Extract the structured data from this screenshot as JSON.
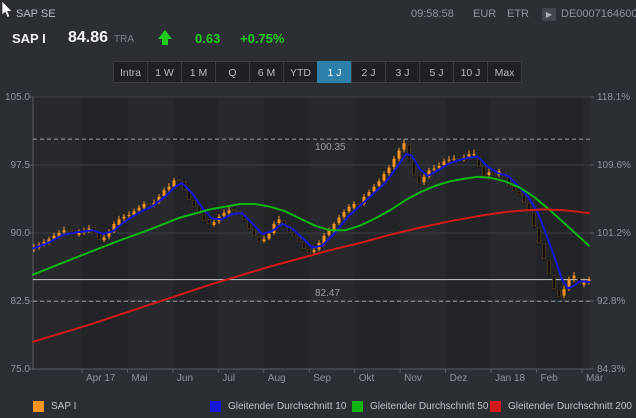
{
  "header": {
    "instrument": "SAP SE",
    "time": "09:58:58",
    "currency": "EUR",
    "exchange": "ETR",
    "isin": "DE0007164600",
    "isin_button_glyph": "▶",
    "symbol": "SAP I",
    "price": "84.86",
    "venue": "TRA",
    "change": "0.63",
    "change_pct": "+0.75%",
    "up_color": "#1ecb1e"
  },
  "ranges": {
    "items": [
      "Intra",
      "1 W",
      "1 M",
      "Q",
      "6 M",
      "YTD",
      "1 J",
      "2 J",
      "3 J",
      "5 J",
      "10 J",
      "Max"
    ],
    "selected": "1 J"
  },
  "legend": [
    {
      "label": "SAP I",
      "color": "#f7941e"
    },
    {
      "label": "Gleitender Durchschnitt 10",
      "color": "#1717d8"
    },
    {
      "label": "Gleitender Durchschnitt 50",
      "color": "#0fb50f"
    },
    {
      "label": "Gleitender Durchschnitt 200",
      "color": "#d21a1a"
    }
  ],
  "chart_data": {
    "type": "candlestick",
    "period": "1 J",
    "ylim": [
      75,
      105
    ],
    "y_axis_left_labels": [
      "105.0",
      "97.5",
      "90.0",
      "82.5",
      "75.0"
    ],
    "y_axis_left_values": [
      105.0,
      97.5,
      90.0,
      82.5,
      75.0
    ],
    "y_axis_right_labels": [
      "118.1%",
      "109.6%",
      "101.2%",
      "92.8%",
      "84.3%"
    ],
    "x_axis_labels": [
      "Apr 17",
      "Mai",
      "Jun",
      "Jul",
      "Aug",
      "Sep",
      "Okt",
      "Nov",
      "Dez",
      "Jan 18",
      "Feb",
      "Mär"
    ],
    "annotations": {
      "period_high": {
        "label": "100.35",
        "price": 100.35
      },
      "period_low": {
        "label": "82.47",
        "price": 82.47
      },
      "last_price": {
        "price": 84.86
      }
    },
    "colors": {
      "candle_up": "#f7941e",
      "candle_down": "#101010",
      "ma10": "#1717d8",
      "ma50": "#0fb50f",
      "ma200": "#d21a1a",
      "grid": "#3c4046",
      "axis": "#585c63",
      "band_light": "#27292d",
      "band_dark": "#222428",
      "dashed_line": "#9aa0a6",
      "last_price_line": "#c7cbd1"
    },
    "candles": [
      [
        88.2,
        88.8,
        87.9,
        88.4
      ],
      [
        88.4,
        89.0,
        88.2,
        88.7
      ],
      [
        88.8,
        89.3,
        88.5,
        89.0
      ],
      [
        88.9,
        89.6,
        88.7,
        89.3
      ],
      [
        89.4,
        90.0,
        89.2,
        89.7
      ],
      [
        89.6,
        90.3,
        89.4,
        90.0
      ],
      [
        90.1,
        90.7,
        89.8,
        90.3
      ],
      [
        90.4,
        90.8,
        90.0,
        90.2
      ],
      [
        90.3,
        90.5,
        89.6,
        89.9
      ],
      [
        89.8,
        90.4,
        89.6,
        90.0
      ],
      [
        90.1,
        90.6,
        89.8,
        90.2
      ],
      [
        90.3,
        90.9,
        90.0,
        90.5
      ],
      [
        90.6,
        90.8,
        89.8,
        90.0
      ],
      [
        90.1,
        90.2,
        89.0,
        89.3
      ],
      [
        89.2,
        89.9,
        89.0,
        89.5
      ],
      [
        89.6,
        90.4,
        89.3,
        90.1
      ],
      [
        90.2,
        91.3,
        90.0,
        91.0
      ],
      [
        90.9,
        91.9,
        90.7,
        91.5
      ],
      [
        91.6,
        92.1,
        91.3,
        91.8
      ],
      [
        91.9,
        92.4,
        91.6,
        92.0
      ],
      [
        92.0,
        92.7,
        91.8,
        92.4
      ],
      [
        92.5,
        93.1,
        92.2,
        92.8
      ],
      [
        92.8,
        93.5,
        92.6,
        93.2
      ],
      [
        93.3,
        93.6,
        92.8,
        93.1
      ],
      [
        93.1,
        93.7,
        92.9,
        93.3
      ],
      [
        93.4,
        94.3,
        93.2,
        94.0
      ],
      [
        94.1,
        95.0,
        93.8,
        94.7
      ],
      [
        94.8,
        95.5,
        94.5,
        95.1
      ],
      [
        95.1,
        96.1,
        94.9,
        95.8
      ],
      [
        95.9,
        96.4,
        95.4,
        95.8
      ],
      [
        95.7,
        95.9,
        94.5,
        94.8
      ],
      [
        94.7,
        94.9,
        93.4,
        93.7
      ],
      [
        93.6,
        94.1,
        92.6,
        92.9
      ],
      [
        93.0,
        93.2,
        91.8,
        92.1
      ],
      [
        92.0,
        92.3,
        91.1,
        91.4
      ],
      [
        91.5,
        91.7,
        90.6,
        91.0
      ],
      [
        90.9,
        91.6,
        90.7,
        91.2
      ],
      [
        91.3,
        92.1,
        91.0,
        91.8
      ],
      [
        91.9,
        92.6,
        91.7,
        92.2
      ],
      [
        92.2,
        92.9,
        92.0,
        92.5
      ],
      [
        92.6,
        92.9,
        92.2,
        92.5
      ],
      [
        92.4,
        92.7,
        91.9,
        92.2
      ],
      [
        92.1,
        92.3,
        91.2,
        91.5
      ],
      [
        91.4,
        91.6,
        90.2,
        90.5
      ],
      [
        90.4,
        90.7,
        89.4,
        89.7
      ],
      [
        89.6,
        89.9,
        88.8,
        89.1
      ],
      [
        89.1,
        89.7,
        88.9,
        89.3
      ],
      [
        89.4,
        90.2,
        89.2,
        89.9
      ],
      [
        90.0,
        91.3,
        89.8,
        91.0
      ],
      [
        91.1,
        91.9,
        90.8,
        91.5
      ],
      [
        91.4,
        91.6,
        90.6,
        90.9
      ],
      [
        90.8,
        91.0,
        89.8,
        90.1
      ],
      [
        90.0,
        90.3,
        89.3,
        89.6
      ],
      [
        89.5,
        89.8,
        88.8,
        89.1
      ],
      [
        89.0,
        89.2,
        88.0,
        88.3
      ],
      [
        88.2,
        88.5,
        87.6,
        87.8
      ],
      [
        87.9,
        88.4,
        87.6,
        88.1
      ],
      [
        88.2,
        89.2,
        88.0,
        88.9
      ],
      [
        88.8,
        90.0,
        88.6,
        89.7
      ],
      [
        89.8,
        90.6,
        89.6,
        90.3
      ],
      [
        90.2,
        91.2,
        90.0,
        91.0
      ],
      [
        91.1,
        92.0,
        90.9,
        91.7
      ],
      [
        91.8,
        92.6,
        91.5,
        92.3
      ],
      [
        92.4,
        93.2,
        92.2,
        92.9
      ],
      [
        92.8,
        93.5,
        92.6,
        93.2
      ],
      [
        93.2,
        93.4,
        92.7,
        93.1
      ],
      [
        93.2,
        94.3,
        93.0,
        94.0
      ],
      [
        94.1,
        94.8,
        93.8,
        94.5
      ],
      [
        94.6,
        95.4,
        94.4,
        95.1
      ],
      [
        95.2,
        96.0,
        94.9,
        95.7
      ],
      [
        95.8,
        96.8,
        95.6,
        96.5
      ],
      [
        96.6,
        97.5,
        96.3,
        97.2
      ],
      [
        97.3,
        98.5,
        97.0,
        98.2
      ],
      [
        98.2,
        99.4,
        97.9,
        99.1
      ],
      [
        99.2,
        100.35,
        98.9,
        99.9
      ],
      [
        99.7,
        99.9,
        97.9,
        98.2
      ],
      [
        98.1,
        98.3,
        96.1,
        96.4
      ],
      [
        96.3,
        96.5,
        95.0,
        95.5
      ],
      [
        95.6,
        96.5,
        95.3,
        96.2
      ],
      [
        96.2,
        97.2,
        96.0,
        96.9
      ],
      [
        97.0,
        97.5,
        96.7,
        97.1
      ],
      [
        97.2,
        97.8,
        96.9,
        97.4
      ],
      [
        97.5,
        98.2,
        97.2,
        97.9
      ],
      [
        98.0,
        98.5,
        97.7,
        98.1
      ],
      [
        98.1,
        98.6,
        97.8,
        98.2
      ],
      [
        98.2,
        98.4,
        97.7,
        98.1
      ],
      [
        98.1,
        98.7,
        97.9,
        98.3
      ],
      [
        98.4,
        99.1,
        98.2,
        98.7
      ],
      [
        98.7,
        99.2,
        98.3,
        98.7
      ],
      [
        98.5,
        98.7,
        97.1,
        97.4
      ],
      [
        97.3,
        97.5,
        96.1,
        96.4
      ],
      [
        96.4,
        97.1,
        96.2,
        96.7
      ],
      [
        96.6,
        96.9,
        96.0,
        96.4
      ],
      [
        96.4,
        97.1,
        96.2,
        96.8
      ],
      [
        96.7,
        96.9,
        95.9,
        96.2
      ],
      [
        96.1,
        96.3,
        94.9,
        95.2
      ],
      [
        95.1,
        95.4,
        94.4,
        94.7
      ],
      [
        94.6,
        94.9,
        94.0,
        94.3
      ],
      [
        94.3,
        94.5,
        93.1,
        93.4
      ],
      [
        93.3,
        93.5,
        92.0,
        92.3
      ],
      [
        92.2,
        92.4,
        90.5,
        90.8
      ],
      [
        90.6,
        90.9,
        88.6,
        88.9
      ],
      [
        88.8,
        89.1,
        86.9,
        87.2
      ],
      [
        87.0,
        87.3,
        85.1,
        85.5
      ],
      [
        85.3,
        85.7,
        83.5,
        83.9
      ],
      [
        83.7,
        84.2,
        82.47,
        83.0
      ],
      [
        83.1,
        84.2,
        82.8,
        83.8
      ],
      [
        83.9,
        85.2,
        83.6,
        84.9
      ],
      [
        85.0,
        85.7,
        84.6,
        85.3
      ],
      [
        85.1,
        85.3,
        83.9,
        84.4
      ],
      [
        84.3,
        85.0,
        84.0,
        84.6
      ],
      [
        84.7,
        85.2,
        84.3,
        84.9
      ]
    ],
    "ma10": {
      "name": "Gleitender Durchschnitt 10",
      "points": [
        [
          33,
          88.3
        ],
        [
          48,
          88.9
        ],
        [
          63,
          89.8
        ],
        [
          78,
          90.1
        ],
        [
          93,
          90.3
        ],
        [
          103,
          89.9
        ],
        [
          113,
          90.2
        ],
        [
          123,
          91.1
        ],
        [
          138,
          92.2
        ],
        [
          153,
          93.0
        ],
        [
          166,
          94.1
        ],
        [
          176,
          95.2
        ],
        [
          182,
          95.5
        ],
        [
          192,
          94.4
        ],
        [
          202,
          92.8
        ],
        [
          212,
          91.6
        ],
        [
          222,
          91.5
        ],
        [
          232,
          92.1
        ],
        [
          242,
          92.2
        ],
        [
          252,
          91.1
        ],
        [
          262,
          89.9
        ],
        [
          272,
          90.2
        ],
        [
          282,
          91.0
        ],
        [
          292,
          90.5
        ],
        [
          302,
          89.5
        ],
        [
          312,
          88.4
        ],
        [
          322,
          88.6
        ],
        [
          334,
          89.9
        ],
        [
          348,
          91.8
        ],
        [
          360,
          93.0
        ],
        [
          372,
          94.2
        ],
        [
          384,
          95.4
        ],
        [
          396,
          97.1
        ],
        [
          406,
          98.7
        ],
        [
          412,
          98.5
        ],
        [
          420,
          97.0
        ],
        [
          428,
          96.3
        ],
        [
          438,
          96.9
        ],
        [
          448,
          97.6
        ],
        [
          458,
          98.0
        ],
        [
          468,
          98.3
        ],
        [
          478,
          98.4
        ],
        [
          488,
          97.3
        ],
        [
          498,
          96.6
        ],
        [
          508,
          96.3
        ],
        [
          518,
          95.2
        ],
        [
          528,
          94.0
        ],
        [
          538,
          92.2
        ],
        [
          546,
          89.9
        ],
        [
          554,
          87.5
        ],
        [
          562,
          84.9
        ],
        [
          568,
          83.9
        ],
        [
          574,
          84.2
        ],
        [
          580,
          84.7
        ],
        [
          589,
          84.6
        ]
      ]
    },
    "ma50": {
      "name": "Gleitender Durchschnitt 50",
      "points": [
        [
          33,
          85.4
        ],
        [
          60,
          86.6
        ],
        [
          90,
          87.9
        ],
        [
          120,
          89.2
        ],
        [
          150,
          90.4
        ],
        [
          180,
          91.7
        ],
        [
          210,
          92.6
        ],
        [
          240,
          93.2
        ],
        [
          255,
          93.2
        ],
        [
          270,
          92.9
        ],
        [
          285,
          92.4
        ],
        [
          300,
          91.6
        ],
        [
          315,
          90.8
        ],
        [
          330,
          90.3
        ],
        [
          345,
          90.3
        ],
        [
          360,
          90.8
        ],
        [
          375,
          91.6
        ],
        [
          390,
          92.5
        ],
        [
          405,
          93.6
        ],
        [
          420,
          94.5
        ],
        [
          435,
          95.2
        ],
        [
          450,
          95.7
        ],
        [
          465,
          96.0
        ],
        [
          478,
          96.2
        ],
        [
          490,
          96.1
        ],
        [
          505,
          95.7
        ],
        [
          520,
          95.0
        ],
        [
          535,
          93.9
        ],
        [
          550,
          92.5
        ],
        [
          565,
          91.0
        ],
        [
          577,
          89.8
        ],
        [
          589,
          88.6
        ]
      ]
    },
    "ma200": {
      "name": "Gleitender Durchschnitt 200",
      "points": [
        [
          33,
          78.0
        ],
        [
          60,
          78.9
        ],
        [
          90,
          79.9
        ],
        [
          120,
          81.0
        ],
        [
          150,
          82.1
        ],
        [
          180,
          83.2
        ],
        [
          210,
          84.3
        ],
        [
          240,
          85.3
        ],
        [
          270,
          86.3
        ],
        [
          300,
          87.2
        ],
        [
          330,
          88.1
        ],
        [
          360,
          88.9
        ],
        [
          390,
          89.8
        ],
        [
          420,
          90.6
        ],
        [
          450,
          91.3
        ],
        [
          480,
          91.9
        ],
        [
          505,
          92.3
        ],
        [
          525,
          92.5
        ],
        [
          545,
          92.6
        ],
        [
          565,
          92.5
        ],
        [
          589,
          92.2
        ]
      ]
    }
  }
}
